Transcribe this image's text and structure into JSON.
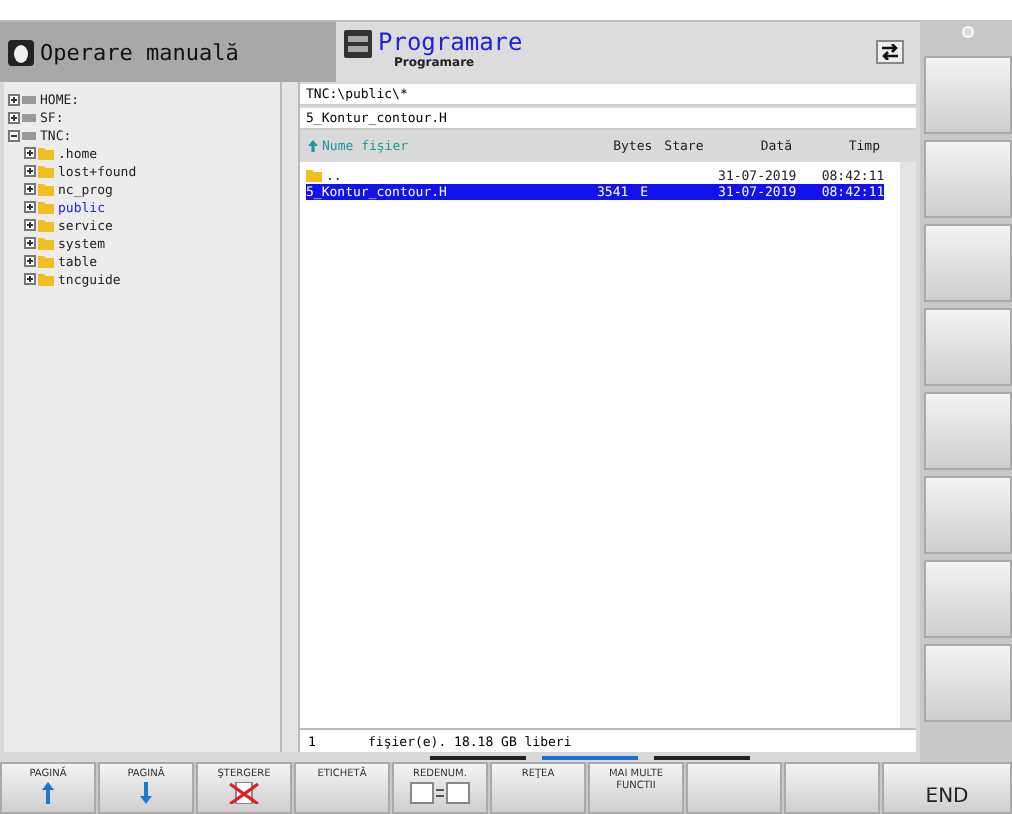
{
  "header": {
    "mode_tab": {
      "label": "Operare manuală",
      "selected": false
    },
    "program_tab": {
      "label": "Programare",
      "sublabel": "Programare",
      "selected": true
    }
  },
  "tree": [
    {
      "label": "HOME:",
      "expanded": false,
      "kind": "drive",
      "selected": false
    },
    {
      "label": "SF:",
      "expanded": false,
      "kind": "drive",
      "selected": false
    },
    {
      "label": "TNC:",
      "expanded": true,
      "kind": "drive",
      "selected": false,
      "children": [
        {
          "label": ".home",
          "expanded": false,
          "kind": "folder",
          "selected": false
        },
        {
          "label": "lost+found",
          "expanded": false,
          "kind": "folder",
          "selected": false
        },
        {
          "label": "nc_prog",
          "expanded": false,
          "kind": "folder",
          "selected": false
        },
        {
          "label": "public",
          "expanded": false,
          "kind": "folder",
          "selected": true
        },
        {
          "label": "service",
          "expanded": false,
          "kind": "folder",
          "selected": false
        },
        {
          "label": "system",
          "expanded": false,
          "kind": "folder",
          "selected": false
        },
        {
          "label": "table",
          "expanded": false,
          "kind": "folder",
          "selected": false
        },
        {
          "label": "tncguide",
          "expanded": false,
          "kind": "folder",
          "selected": false
        }
      ]
    }
  ],
  "path": "TNC:\\public\\*",
  "current_file": "5_Kontur_contour.H",
  "table": {
    "columns": [
      "Nume fişier",
      "Bytes",
      "Stare",
      "Dată",
      "Timp"
    ],
    "rows": [
      {
        "kind": "parent",
        "name": "..",
        "date": "31-07-2019",
        "time": "08:42:11",
        "selected": false
      },
      {
        "kind": "file",
        "name": "5_Kontur_contour.H",
        "bytes": "3541",
        "status": "E",
        "date": "31-07-2019",
        "time": "08:42:11",
        "selected": true
      }
    ]
  },
  "status_bar": {
    "count": "1",
    "text": "fişier(e).  18.18 GB liberi"
  },
  "softkey_pages": [
    {
      "selected": false
    },
    {
      "selected": true
    },
    {
      "selected": false
    }
  ],
  "softkeys": [
    {
      "label": "PAGINĂ",
      "kind": "up"
    },
    {
      "label": "PAGINĂ",
      "kind": "down"
    },
    {
      "label": "ŞTERGERE",
      "kind": "delete"
    },
    {
      "label": "ETICHETĂ",
      "kind": "text"
    },
    {
      "label": "REDENUM.",
      "kind": "rename"
    },
    {
      "label": "REŢEA",
      "kind": "text"
    },
    {
      "label": "MAI MULTE FUNCTII",
      "kind": "text"
    },
    {
      "kind": "empty"
    },
    {
      "kind": "empty"
    }
  ],
  "end_key": "END"
}
